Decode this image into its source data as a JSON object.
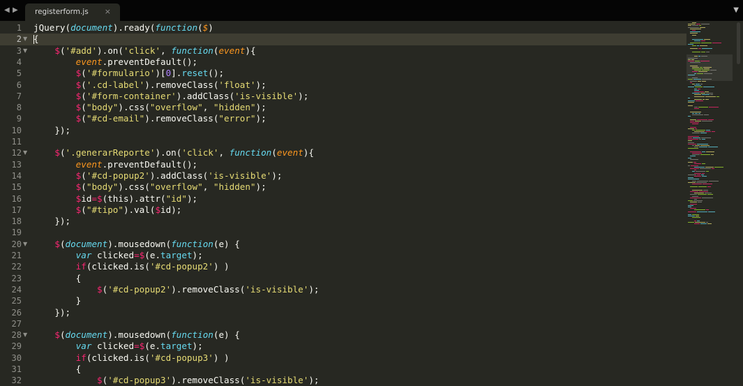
{
  "tabbar": {
    "back_icon": "triangle-left-icon",
    "forward_icon": "triangle-right-icon",
    "dropdown_icon": "triangle-down-icon",
    "tab": {
      "title": "registerform.js",
      "close_glyph": "×"
    }
  },
  "editor": {
    "current_line": 2,
    "colors": {
      "background": "#272822",
      "current_line": "#3e3d32",
      "plain": "#f8f8f2",
      "keyword": "#66d9ef",
      "string": "#e6db74",
      "number": "#ae81ff",
      "operator": "#f92672",
      "parameter": "#fd971f",
      "gutter": "#90908a"
    },
    "lines": [
      {
        "n": "1",
        "fold": false,
        "tokens": [
          [
            "plain",
            "jQuery("
          ],
          [
            "kw",
            "document"
          ],
          [
            "plain",
            ").ready("
          ],
          [
            "kw",
            "function"
          ],
          [
            "plain",
            "("
          ],
          [
            "param",
            "$"
          ],
          [
            "plain",
            ")"
          ]
        ]
      },
      {
        "n": "2",
        "fold": true,
        "tokens": [
          [
            "plain",
            "{"
          ]
        ]
      },
      {
        "n": "3",
        "fold": true,
        "tokens": [
          [
            "plain",
            "    "
          ],
          [
            "op",
            "$"
          ],
          [
            "plain",
            "("
          ],
          [
            "str",
            "'#add'"
          ],
          [
            "plain",
            ").on("
          ],
          [
            "str",
            "'click'"
          ],
          [
            "plain",
            ", "
          ],
          [
            "kw",
            "function"
          ],
          [
            "plain",
            "("
          ],
          [
            "param",
            "event"
          ],
          [
            "plain",
            "){"
          ]
        ]
      },
      {
        "n": "4",
        "fold": false,
        "tokens": [
          [
            "plain",
            "        "
          ],
          [
            "param",
            "event"
          ],
          [
            "plain",
            ".preventDefault();"
          ]
        ]
      },
      {
        "n": "5",
        "fold": false,
        "tokens": [
          [
            "plain",
            "        "
          ],
          [
            "op",
            "$"
          ],
          [
            "plain",
            "("
          ],
          [
            "str",
            "'#formulario'"
          ],
          [
            "plain",
            ")["
          ],
          [
            "num",
            "0"
          ],
          [
            "plain",
            "]."
          ],
          [
            "fn",
            "reset"
          ],
          [
            "plain",
            "();"
          ]
        ]
      },
      {
        "n": "6",
        "fold": false,
        "tokens": [
          [
            "plain",
            "        "
          ],
          [
            "op",
            "$"
          ],
          [
            "plain",
            "("
          ],
          [
            "str",
            "'.cd-label'"
          ],
          [
            "plain",
            ").removeClass("
          ],
          [
            "str",
            "'float'"
          ],
          [
            "plain",
            ");"
          ]
        ]
      },
      {
        "n": "7",
        "fold": false,
        "tokens": [
          [
            "plain",
            "        "
          ],
          [
            "op",
            "$"
          ],
          [
            "plain",
            "("
          ],
          [
            "str",
            "'#form-container'"
          ],
          [
            "plain",
            ").addClass("
          ],
          [
            "str",
            "'is-visible'"
          ],
          [
            "plain",
            ");"
          ]
        ]
      },
      {
        "n": "8",
        "fold": false,
        "tokens": [
          [
            "plain",
            "        "
          ],
          [
            "op",
            "$"
          ],
          [
            "plain",
            "("
          ],
          [
            "str",
            "\"body\""
          ],
          [
            "plain",
            ").css("
          ],
          [
            "str",
            "\"overflow\""
          ],
          [
            "plain",
            ", "
          ],
          [
            "str",
            "\"hidden\""
          ],
          [
            "plain",
            ");"
          ]
        ]
      },
      {
        "n": "9",
        "fold": false,
        "tokens": [
          [
            "plain",
            "        "
          ],
          [
            "op",
            "$"
          ],
          [
            "plain",
            "("
          ],
          [
            "str",
            "\"#cd-email\""
          ],
          [
            "plain",
            ").removeClass("
          ],
          [
            "str",
            "\"error\""
          ],
          [
            "plain",
            ");"
          ]
        ]
      },
      {
        "n": "10",
        "fold": false,
        "tokens": [
          [
            "plain",
            "    });"
          ]
        ]
      },
      {
        "n": "11",
        "fold": false,
        "tokens": []
      },
      {
        "n": "12",
        "fold": true,
        "tokens": [
          [
            "plain",
            "    "
          ],
          [
            "op",
            "$"
          ],
          [
            "plain",
            "("
          ],
          [
            "str",
            "'.generarReporte'"
          ],
          [
            "plain",
            ").on("
          ],
          [
            "str",
            "'click'"
          ],
          [
            "plain",
            ", "
          ],
          [
            "kw",
            "function"
          ],
          [
            "plain",
            "("
          ],
          [
            "param",
            "event"
          ],
          [
            "plain",
            "){"
          ]
        ]
      },
      {
        "n": "13",
        "fold": false,
        "tokens": [
          [
            "plain",
            "        "
          ],
          [
            "param",
            "event"
          ],
          [
            "plain",
            ".preventDefault();"
          ]
        ]
      },
      {
        "n": "14",
        "fold": false,
        "tokens": [
          [
            "plain",
            "        "
          ],
          [
            "op",
            "$"
          ],
          [
            "plain",
            "("
          ],
          [
            "str",
            "'#cd-popup2'"
          ],
          [
            "plain",
            ").addClass("
          ],
          [
            "str",
            "'is-visible'"
          ],
          [
            "plain",
            ");"
          ]
        ]
      },
      {
        "n": "15",
        "fold": false,
        "tokens": [
          [
            "plain",
            "        "
          ],
          [
            "op",
            "$"
          ],
          [
            "plain",
            "("
          ],
          [
            "str",
            "\"body\""
          ],
          [
            "plain",
            ").css("
          ],
          [
            "str",
            "\"overflow\""
          ],
          [
            "plain",
            ", "
          ],
          [
            "str",
            "\"hidden\""
          ],
          [
            "plain",
            ");"
          ]
        ]
      },
      {
        "n": "16",
        "fold": false,
        "tokens": [
          [
            "plain",
            "        "
          ],
          [
            "op",
            "$"
          ],
          [
            "plain",
            "id"
          ],
          [
            "op",
            "="
          ],
          [
            "op",
            "$"
          ],
          [
            "plain",
            "(this).attr("
          ],
          [
            "str",
            "\"id\""
          ],
          [
            "plain",
            ");"
          ]
        ]
      },
      {
        "n": "17",
        "fold": false,
        "tokens": [
          [
            "plain",
            "        "
          ],
          [
            "op",
            "$"
          ],
          [
            "plain",
            "("
          ],
          [
            "str",
            "\"#tipo\""
          ],
          [
            "plain",
            ").val("
          ],
          [
            "op",
            "$"
          ],
          [
            "plain",
            "id);"
          ]
        ]
      },
      {
        "n": "18",
        "fold": false,
        "tokens": [
          [
            "plain",
            "    });"
          ]
        ]
      },
      {
        "n": "19",
        "fold": false,
        "tokens": []
      },
      {
        "n": "20",
        "fold": true,
        "tokens": [
          [
            "plain",
            "    "
          ],
          [
            "op",
            "$"
          ],
          [
            "plain",
            "("
          ],
          [
            "kw",
            "document"
          ],
          [
            "plain",
            ").mousedown("
          ],
          [
            "kw",
            "function"
          ],
          [
            "plain",
            "(e) {"
          ]
        ]
      },
      {
        "n": "21",
        "fold": false,
        "tokens": [
          [
            "plain",
            "        "
          ],
          [
            "kw",
            "var"
          ],
          [
            "plain",
            " clicked"
          ],
          [
            "op",
            "="
          ],
          [
            "op",
            "$"
          ],
          [
            "plain",
            "(e."
          ],
          [
            "fn",
            "target"
          ],
          [
            "plain",
            ");"
          ]
        ]
      },
      {
        "n": "22",
        "fold": false,
        "tokens": [
          [
            "plain",
            "        "
          ],
          [
            "op",
            "if"
          ],
          [
            "plain",
            "(clicked.is("
          ],
          [
            "str",
            "'#cd-popup2'"
          ],
          [
            "plain",
            ") )"
          ]
        ]
      },
      {
        "n": "23",
        "fold": false,
        "tokens": [
          [
            "plain",
            "        {"
          ]
        ]
      },
      {
        "n": "24",
        "fold": false,
        "tokens": [
          [
            "plain",
            "            "
          ],
          [
            "op",
            "$"
          ],
          [
            "plain",
            "("
          ],
          [
            "str",
            "'#cd-popup2'"
          ],
          [
            "plain",
            ").removeClass("
          ],
          [
            "str",
            "'is-visible'"
          ],
          [
            "plain",
            ");"
          ]
        ]
      },
      {
        "n": "25",
        "fold": false,
        "tokens": [
          [
            "plain",
            "        }"
          ]
        ]
      },
      {
        "n": "26",
        "fold": false,
        "tokens": [
          [
            "plain",
            "    });"
          ]
        ]
      },
      {
        "n": "27",
        "fold": false,
        "tokens": []
      },
      {
        "n": "28",
        "fold": true,
        "tokens": [
          [
            "plain",
            "    "
          ],
          [
            "op",
            "$"
          ],
          [
            "plain",
            "("
          ],
          [
            "kw",
            "document"
          ],
          [
            "plain",
            ").mousedown("
          ],
          [
            "kw",
            "function"
          ],
          [
            "plain",
            "(e) {"
          ]
        ]
      },
      {
        "n": "29",
        "fold": false,
        "tokens": [
          [
            "plain",
            "        "
          ],
          [
            "kw",
            "var"
          ],
          [
            "plain",
            " clicked"
          ],
          [
            "op",
            "="
          ],
          [
            "op",
            "$"
          ],
          [
            "plain",
            "(e."
          ],
          [
            "fn",
            "target"
          ],
          [
            "plain",
            ");"
          ]
        ]
      },
      {
        "n": "30",
        "fold": false,
        "tokens": [
          [
            "plain",
            "        "
          ],
          [
            "op",
            "if"
          ],
          [
            "plain",
            "(clicked.is("
          ],
          [
            "str",
            "'#cd-popup3'"
          ],
          [
            "plain",
            ") )"
          ]
        ]
      },
      {
        "n": "31",
        "fold": false,
        "tokens": [
          [
            "plain",
            "        {"
          ]
        ]
      },
      {
        "n": "32",
        "fold": false,
        "tokens": [
          [
            "plain",
            "            "
          ],
          [
            "op",
            "$"
          ],
          [
            "plain",
            "("
          ],
          [
            "str",
            "'#cd-popup3'"
          ],
          [
            "plain",
            ").removeClass("
          ],
          [
            "str",
            "'is-visible'"
          ],
          [
            "plain",
            ");"
          ]
        ]
      }
    ]
  }
}
